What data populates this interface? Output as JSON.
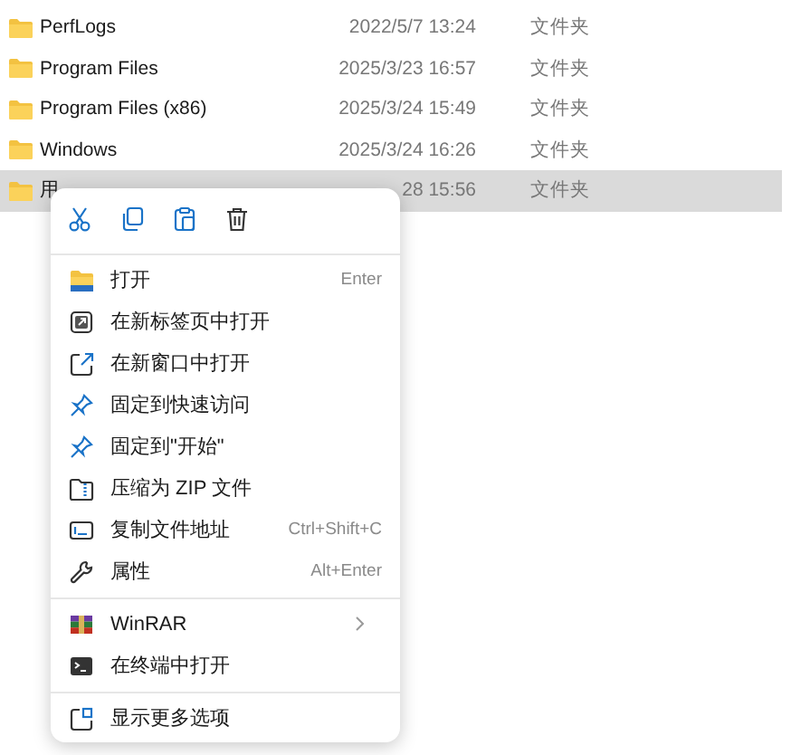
{
  "files": [
    {
      "name": "PerfLogs",
      "modified": "2022/5/7 13:24",
      "type": "文件夹",
      "selected": false
    },
    {
      "name": "Program Files",
      "modified": "2025/3/23 16:57",
      "type": "文件夹",
      "selected": false
    },
    {
      "name": "Program Files (x86)",
      "modified": "2025/3/24 15:49",
      "type": "文件夹",
      "selected": false
    },
    {
      "name": "Windows",
      "modified": "2025/3/24 16:26",
      "type": "文件夹",
      "selected": false
    },
    {
      "name": "用",
      "modified": "28 15:56",
      "type": "文件夹",
      "selected": true
    }
  ],
  "context_menu": {
    "sections": [
      [
        {
          "label": "打开",
          "shortcut": "Enter",
          "has_submenu": false
        },
        {
          "label": "在新标签页中打开",
          "has_submenu": false
        },
        {
          "label": "在新窗口中打开",
          "has_submenu": false
        },
        {
          "label": "固定到快速访问",
          "has_submenu": false
        },
        {
          "label": "固定到\"开始\"",
          "has_submenu": false
        },
        {
          "label": "压缩为 ZIP 文件",
          "has_submenu": false
        },
        {
          "label": "复制文件地址",
          "shortcut": "Ctrl+Shift+C",
          "has_submenu": false
        },
        {
          "label": "属性",
          "shortcut": "Alt+Enter",
          "has_submenu": false
        }
      ],
      [
        {
          "label": "WinRAR",
          "has_submenu": true
        },
        {
          "label": "在终端中打开",
          "has_submenu": false
        }
      ],
      [
        {
          "label": "显示更多选项",
          "has_submenu": false
        }
      ]
    ]
  }
}
